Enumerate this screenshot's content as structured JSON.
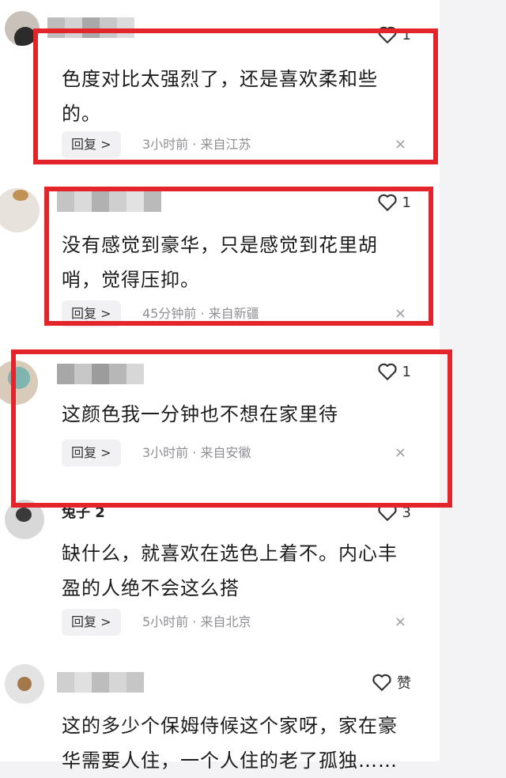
{
  "comments": [
    {
      "text": "色度对比太强烈了，还是喜欢柔和些的。",
      "likes": "1",
      "reply_label": "回复 >",
      "meta": "3小时前 · 来自江苏",
      "close": "×"
    },
    {
      "text": "没有感觉到豪华，只是感觉到花里胡哨，觉得压抑。",
      "likes": "1",
      "reply_label": "回复 >",
      "meta": "45分钟前 · 来自新疆",
      "close": "×"
    },
    {
      "text": "这颜色我一分钟也不想在家里待",
      "likes": "1",
      "reply_label": "回复 >",
      "meta": "3小时前 · 来自安徽",
      "close": "×"
    },
    {
      "username": "兔子 2",
      "text": "缺什么，就喜欢在选色上着不。内心丰盈的人绝不会这么搭",
      "likes": "3",
      "reply_label": "回复 >",
      "meta": "5小时前 · 来自北京",
      "close": "×"
    },
    {
      "text": "这的多少个保姆侍候这个家呀，家在豪华需要人住，一个人住的老了孤独……",
      "likes": "赞"
    }
  ],
  "colors": {
    "highlight_box": "#e3242b",
    "background_right": "#f3f3f5",
    "reply_bg": "#f1f1f3",
    "meta_text": "#8f8f95"
  },
  "icons": {
    "like": "heart-outline-icon",
    "close": "close-icon"
  }
}
